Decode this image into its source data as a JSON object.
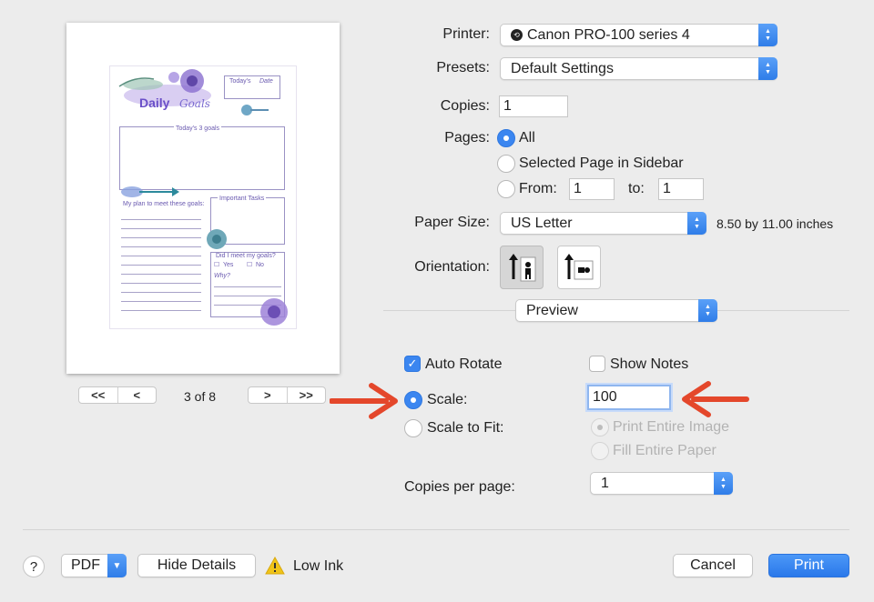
{
  "printer": {
    "label": "Printer:",
    "value": "Canon PRO-100 series 4"
  },
  "presets": {
    "label": "Presets:",
    "value": "Default Settings"
  },
  "copies": {
    "label": "Copies:",
    "value": "1"
  },
  "pages": {
    "label": "Pages:",
    "all": "All",
    "selected": "Selected Page in Sidebar",
    "from_label": "From:",
    "from_value": "1",
    "to_label": "to:",
    "to_value": "1"
  },
  "paper_size": {
    "label": "Paper Size:",
    "value": "US Letter",
    "dimensions": "8.50 by 11.00 inches"
  },
  "orientation": {
    "label": "Orientation:"
  },
  "app_section": {
    "value": "Preview"
  },
  "auto_rotate": {
    "label": "Auto Rotate",
    "checked": true
  },
  "show_notes": {
    "label": "Show Notes",
    "checked": false
  },
  "scale": {
    "label": "Scale:",
    "value": "100"
  },
  "scale_to_fit": {
    "label": "Scale to Fit:",
    "print_entire": "Print Entire Image",
    "fill_entire": "Fill Entire Paper"
  },
  "copies_per_page": {
    "label": "Copies per page:",
    "value": "1"
  },
  "page_nav": {
    "first": "<<",
    "prev": "<",
    "indicator": "3 of 8",
    "next": ">",
    "last": ">>"
  },
  "thumbnail": {
    "title_daily": "Daily",
    "title_goals": "Goals",
    "todays": "Today's",
    "todays_script": "Date",
    "three_goals": "Today's 3 goals",
    "plan": "My plan to meet these goals:",
    "important": "Important Tasks",
    "did_i_meet": "Did I meet my goals?",
    "yes": "Yes",
    "no": "No",
    "why": "Why?"
  },
  "footer": {
    "help": "?",
    "pdf": "PDF",
    "hide_details": "Hide Details",
    "low_ink": "Low Ink",
    "cancel": "Cancel",
    "print": "Print"
  },
  "colors": {
    "accent": "#2f7de8",
    "arrow": "#e4472b",
    "warning": "#f0c419"
  }
}
